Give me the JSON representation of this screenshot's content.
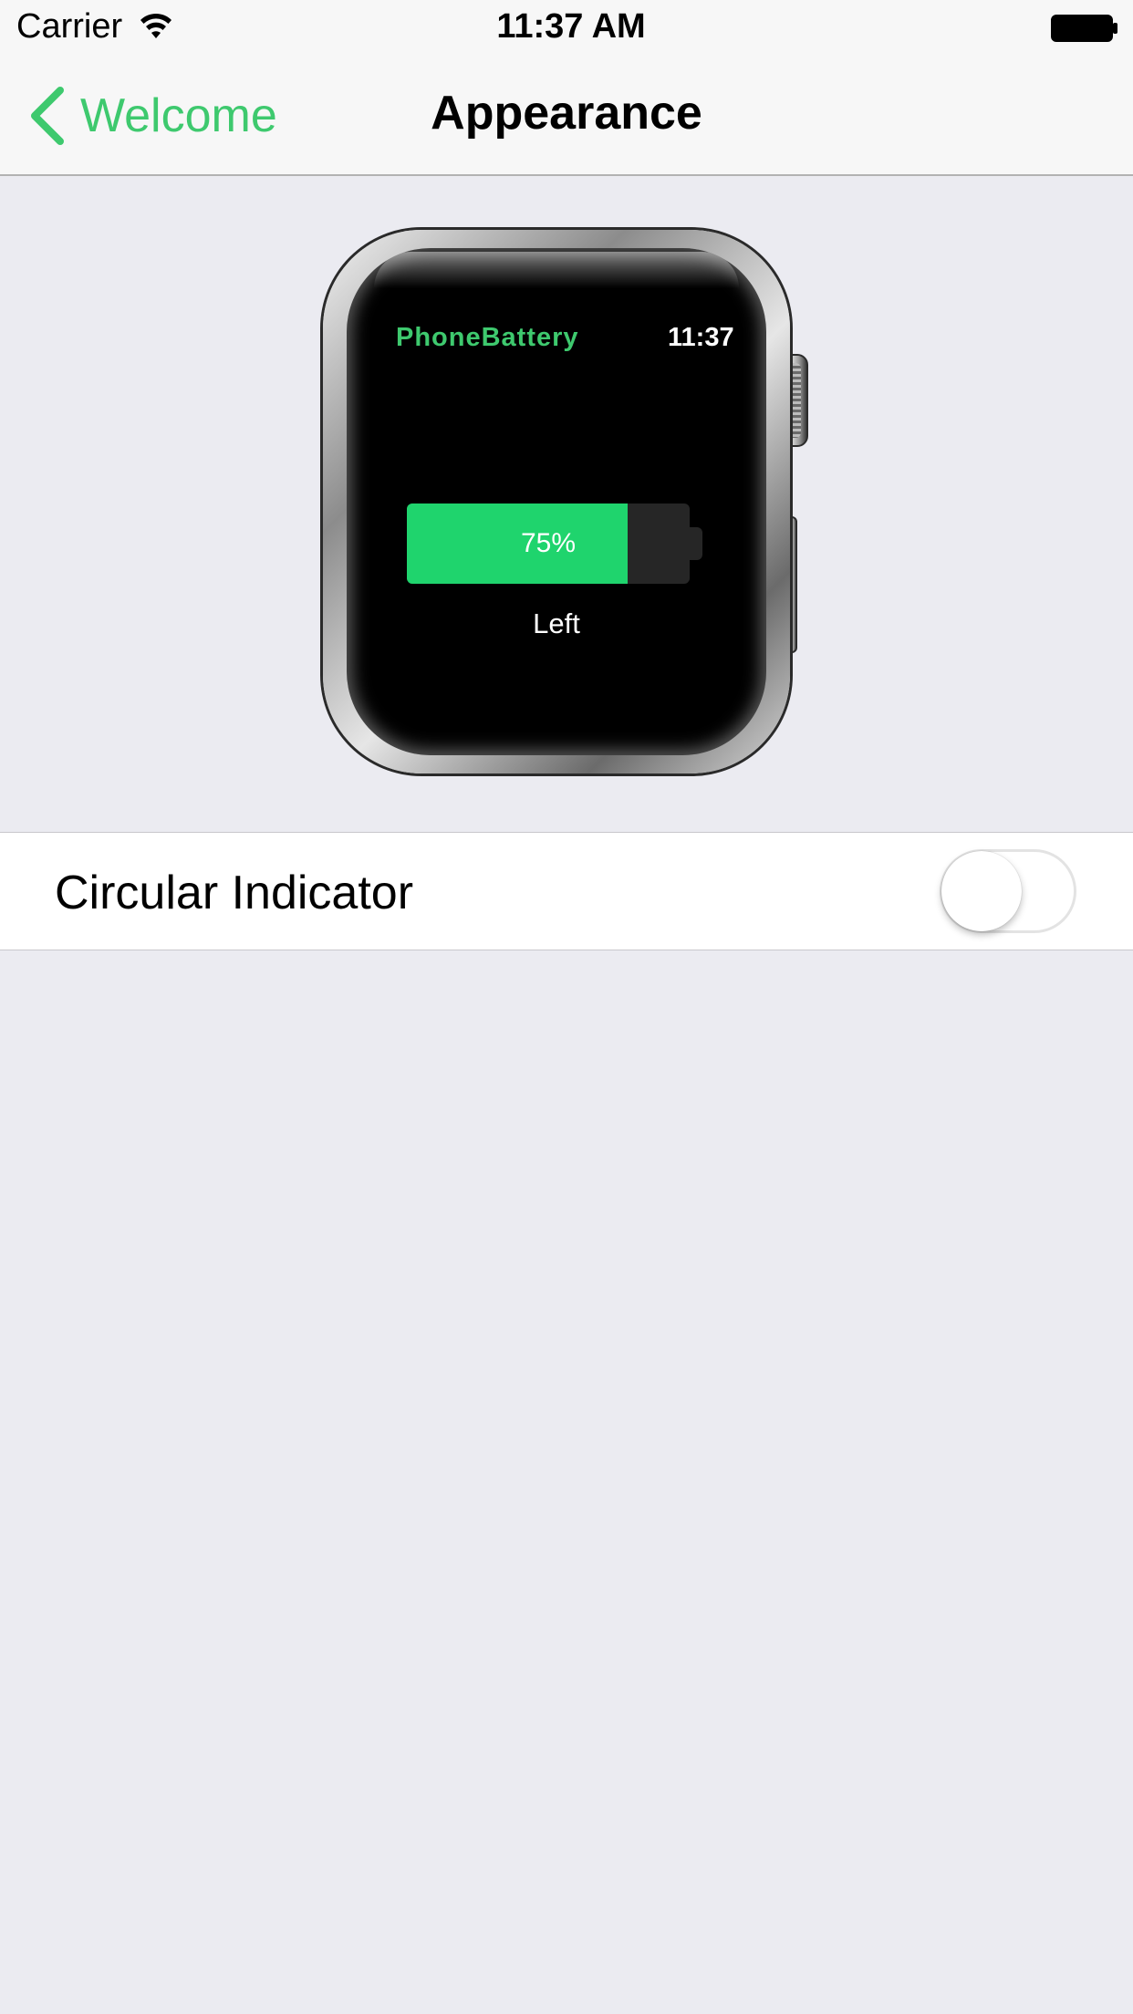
{
  "status_bar": {
    "carrier": "Carrier",
    "time": "11:37 AM",
    "wifi_icon": "wifi-icon",
    "battery_icon": "battery-full-icon"
  },
  "nav": {
    "back_label": "Welcome",
    "back_icon": "chevron-left-icon",
    "title": "Appearance",
    "accent_color": "#3ec96e"
  },
  "watch_preview": {
    "app_name": "PhoneBattery",
    "time": "11:37",
    "battery_percent_label": "75%",
    "battery_level": 0.78,
    "battery_fill_color": "#1fd46d",
    "caption": "Left"
  },
  "settings": {
    "circular_indicator": {
      "label": "Circular Indicator",
      "enabled": false
    }
  }
}
